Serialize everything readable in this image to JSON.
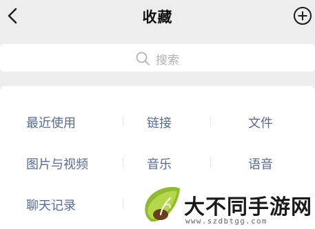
{
  "header": {
    "title": "收藏",
    "back_icon": "chevron-left-icon",
    "add_icon": "plus-circle-icon"
  },
  "search": {
    "placeholder": "搜索",
    "icon": "search-icon"
  },
  "categories": [
    {
      "label": "最近使用"
    },
    {
      "label": "链接"
    },
    {
      "label": "文件"
    },
    {
      "label": "图片与视频"
    },
    {
      "label": "音乐"
    },
    {
      "label": "语音"
    },
    {
      "label": "聊天记录"
    }
  ],
  "watermark": {
    "text": "大不同手游网",
    "url": "www.szdbtgg.com"
  },
  "colors": {
    "background": "#ededed",
    "panel": "#ffffff",
    "link": "#576b95",
    "placeholder": "#b2b2b2",
    "title": "#111111"
  }
}
